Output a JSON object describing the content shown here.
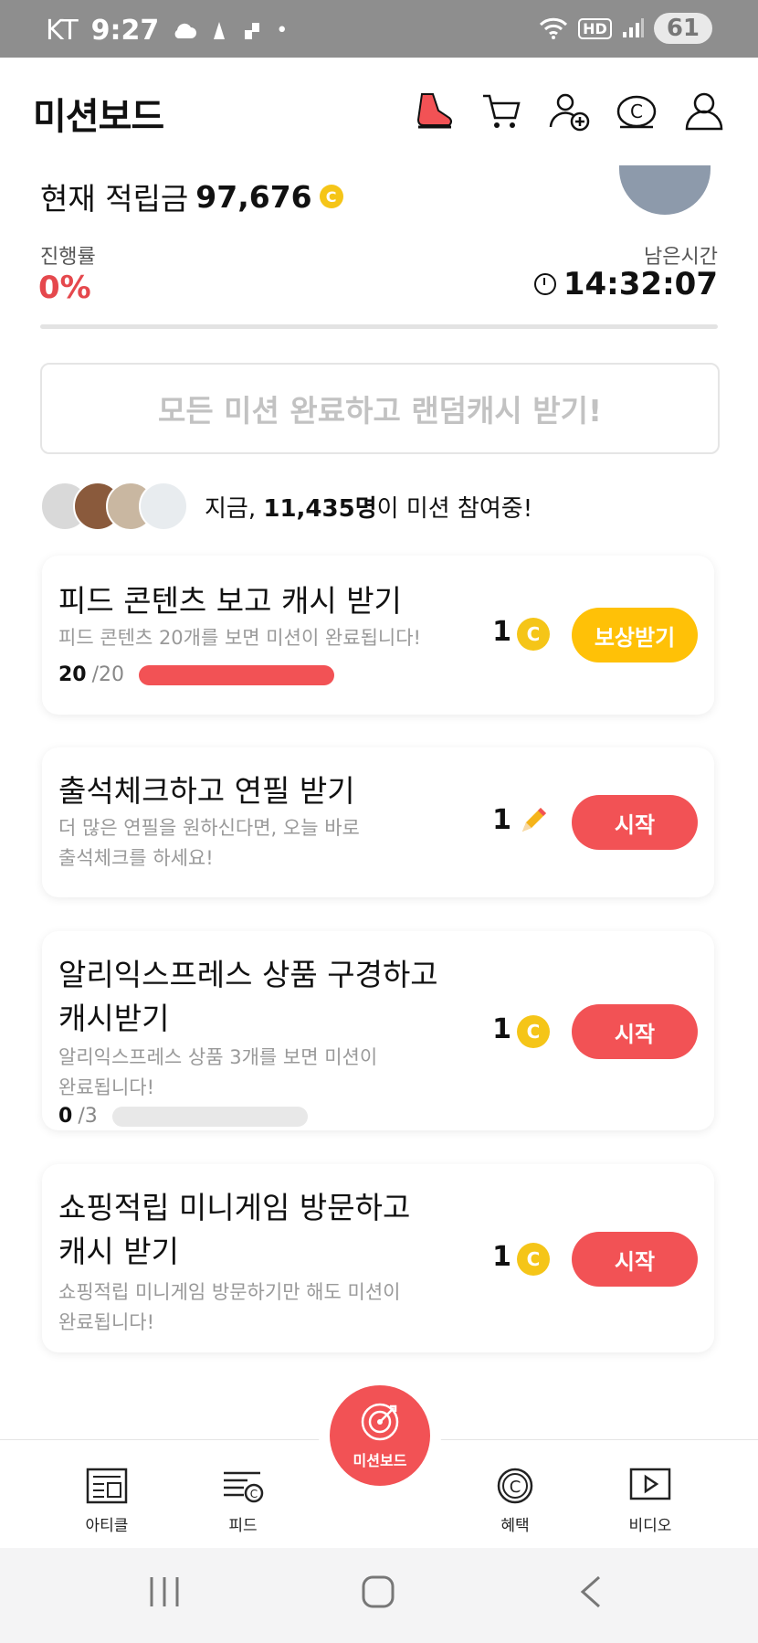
{
  "status_bar": {
    "carrier": "KT",
    "time": "9:27",
    "hd": "HD",
    "battery": "61"
  },
  "header": {
    "title": "미션보드",
    "icons": [
      "shoe-icon",
      "cart-icon",
      "add-friend-icon",
      "coin-icon",
      "profile-icon"
    ]
  },
  "summary": {
    "points_label": "현재 적립금",
    "points_value": "97,676",
    "coin_symbol": "C",
    "progress_label": "진행률",
    "progress_value": "0%",
    "remaining_label": "남은시간",
    "remaining_value": "14:32:07"
  },
  "banner": {
    "text": "모든 미션 완료하고 랜덤캐시 받기!"
  },
  "participants": {
    "prefix": "지금, ",
    "count": "11,435명",
    "suffix": "이 미션 참여중!"
  },
  "missions": [
    {
      "title": "피드 콘텐츠 보고 캐시 받기",
      "desc": "피드 콘텐츠 20개를 보면 미션이 완료됩니다!",
      "amount": "1",
      "reward_icon": "coin-icon",
      "button": "보상받기",
      "progress_current": "20",
      "progress_max": "/20",
      "progress_fraction": 1.0
    },
    {
      "title": "출석체크하고 연필 받기",
      "desc_line1": "더 많은 연필을 원하신다면, 오늘 바로",
      "desc_line2": "출석체크를 하세요!",
      "amount": "1",
      "reward_icon": "pencil-icon",
      "button": "시작"
    },
    {
      "title_line1": "알리익스프레스 상품 구경하고",
      "title_line2": "캐시받기",
      "desc_line1": "알리익스프레스 상품 3개를 보면 미션이",
      "desc_line2": "완료됩니다!",
      "amount": "1",
      "reward_icon": "coin-icon",
      "button": "시작",
      "progress_current": "0",
      "progress_max": "/3",
      "progress_fraction": 0.0
    },
    {
      "title_line1": "쇼핑적립 미니게임 방문하고",
      "title_line2": "캐시 받기",
      "desc_line1": "쇼핑적립 미니게임 방문하기만 해도 미션이",
      "desc_line2": "완료됩니다!",
      "amount": "1",
      "reward_icon": "coin-icon",
      "button": "시작"
    }
  ],
  "bottom_nav": {
    "article": "아티클",
    "feed": "피드",
    "mission": "미션보드",
    "benefit": "혜택",
    "video": "비디오"
  },
  "colors": {
    "accent_red": "#f25255",
    "reward_yellow": "#ffc107",
    "coin": "#f5c518"
  }
}
